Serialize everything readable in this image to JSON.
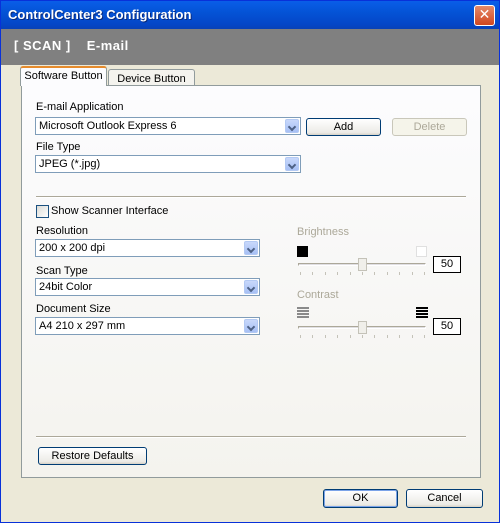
{
  "window": {
    "title": "ControlCenter3 Configuration"
  },
  "header": {
    "section": "[  SCAN  ]",
    "subsection": "E-mail"
  },
  "tabs": [
    {
      "label": "Software Button",
      "active": true
    },
    {
      "label": "Device Button",
      "active": false
    }
  ],
  "email_application": {
    "label": "E-mail Application",
    "value": "Microsoft Outlook  Express 6",
    "add_label": "Add",
    "delete_label": "Delete"
  },
  "file_type": {
    "label": "File Type",
    "value": "JPEG (*.jpg)"
  },
  "show_scanner_interface": {
    "label": "Show Scanner Interface",
    "checked": false
  },
  "resolution": {
    "label": "Resolution",
    "value": "200 x 200 dpi"
  },
  "scan_type": {
    "label": "Scan Type",
    "value": "24bit Color"
  },
  "document_size": {
    "label": "Document Size",
    "value": "A4 210 x 297 mm"
  },
  "brightness": {
    "label": "Brightness",
    "value": "50",
    "level": 0.5
  },
  "contrast": {
    "label": "Contrast",
    "value": "50",
    "level": 0.5
  },
  "footer": {
    "restore_label": "Restore Defaults",
    "ok_label": "OK",
    "cancel_label": "Cancel"
  },
  "colors": {
    "titlebar": "#0453d6",
    "header_band": "#808080",
    "dialog_bg": "#ece9d8",
    "tab_highlight": "#e68b2c",
    "disabled_text": "#aca899"
  },
  "icons": [
    "close-icon",
    "dropdown-arrow-icon",
    "brightness-dark-icon",
    "brightness-light-icon",
    "contrast-low-icon",
    "contrast-high-icon"
  ]
}
